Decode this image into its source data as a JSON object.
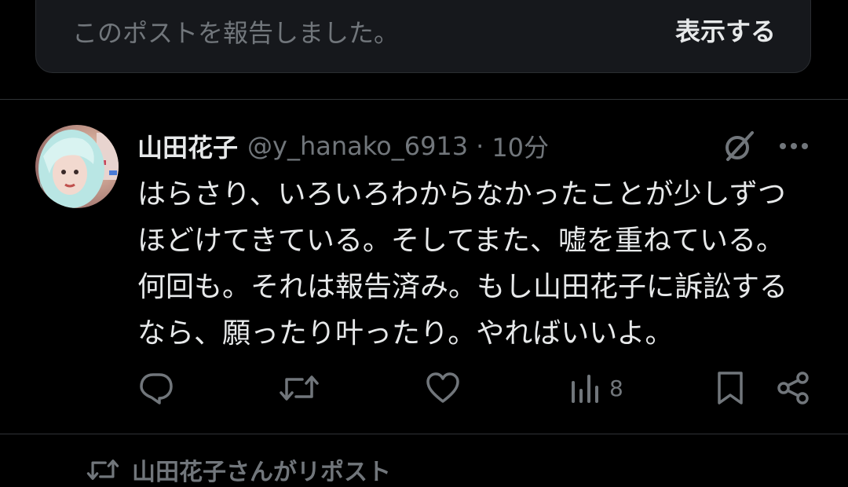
{
  "report_banner": {
    "message": "このポストを報告しました。",
    "show_label": "表示する"
  },
  "post": {
    "display_name": "山田花子",
    "handle": "@y_hanako_6913",
    "separator": "·",
    "time": "10分",
    "body_lines": [
      "はらさり、いろいろわからなかったことが少しずつ",
      "ほどけてきている。そしてまた、嘘を重ねている。",
      "何回も。それは報告済み。もし山田花子に訴訟する",
      "なら、願ったり叶ったり。やればいいよ。"
    ],
    "actions": {
      "reply_icon": "reply-icon",
      "repost_icon": "repost-icon",
      "like_icon": "heart-icon",
      "views_icon": "views-icon",
      "views_count": "8",
      "bookmark_icon": "bookmark-icon",
      "share_icon": "share-icon"
    }
  },
  "next_post": {
    "repost_label": "山田花子さんがリポスト"
  },
  "colors": {
    "background": "#000000",
    "text_primary": "#e7e9ea",
    "text_secondary": "#71767b",
    "divider": "#2f3336",
    "banner": "#16181c"
  }
}
